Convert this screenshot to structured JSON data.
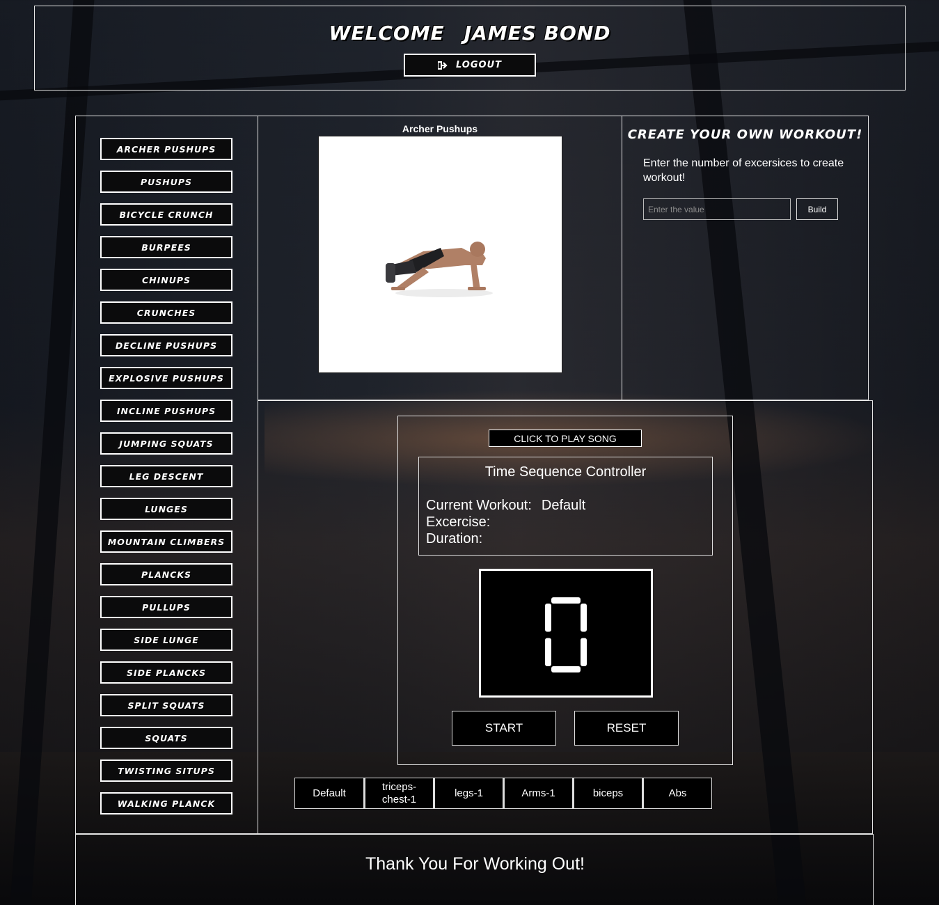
{
  "header": {
    "welcome_text": "WELCOME",
    "user_name": "JAMES BOND",
    "logout_label": "LOGOUT"
  },
  "exercises": [
    "ARCHER PUSHUPS",
    "PUSHUPS",
    "BICYCLE CRUNCH",
    "BURPEES",
    "CHINUPS",
    "CRUNCHES",
    "DECLINE PUSHUPS",
    "EXPLOSIVE PUSHUPS",
    "INCLINE PUSHUPS",
    "JUMPING SQUATS",
    "LEG DESCENT",
    "LUNGES",
    "MOUNTAIN CLIMBERS",
    "PLANCKS",
    "PULLUPS",
    "SIDE LUNGE",
    "SIDE PLANCKS",
    "SPLIT SQUATS",
    "SQUATS",
    "TWISTING SITUPS",
    "WALKING PLANCK"
  ],
  "preview": {
    "title": "Archer Pushups"
  },
  "create_workout": {
    "title": "CREATE YOUR OWN WORKOUT!",
    "description": "Enter the number of excersices to create workout!",
    "input_placeholder": "Enter the value",
    "build_label": "Build"
  },
  "controller": {
    "play_song_label": "CLICK TO PLAY SONG",
    "sequence_title": "Time Sequence Controller",
    "current_workout_label": "Current Workout:",
    "current_workout_value": "Default",
    "exercise_label": "Excercise:",
    "duration_label": "Duration:",
    "timer_value": "0",
    "start_label": "START",
    "reset_label": "RESET"
  },
  "workout_tabs": [
    "Default",
    "triceps-chest-1",
    "legs-1",
    "Arms-1",
    "biceps",
    "Abs"
  ],
  "footer": {
    "message": "Thank You For Working Out!"
  },
  "icons": {
    "logout": "sign-out-icon"
  }
}
